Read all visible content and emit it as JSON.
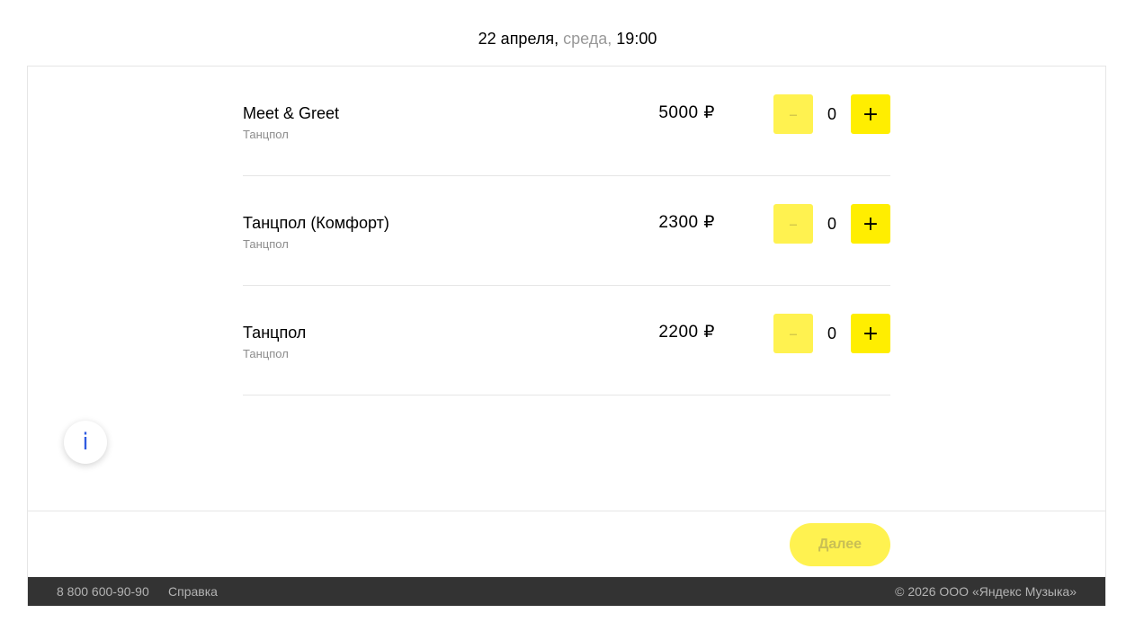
{
  "header": {
    "date": "22 апреля,",
    "weekday": "среда,",
    "time": "19:00"
  },
  "tickets": [
    {
      "name": "Meet & Greet",
      "sector": "Танцпол",
      "price": "5000 ₽",
      "quantity": "0",
      "minus_label": "–",
      "plus_label": "+"
    },
    {
      "name": "Танцпол (Комфорт)",
      "sector": "Танцпол",
      "price": "2300 ₽",
      "quantity": "0",
      "minus_label": "–",
      "plus_label": "+"
    },
    {
      "name": "Танцпол",
      "sector": "Танцпол",
      "price": "2200 ₽",
      "quantity": "0",
      "minus_label": "–",
      "plus_label": "+"
    }
  ],
  "info": {
    "icon": "info-icon",
    "glyph": "i"
  },
  "actions": {
    "next_label": "Далее"
  },
  "footer": {
    "phone": "8 800 600-90-90",
    "help": "Справка",
    "copyright": "© 2026 ООО «Яндекс Музыка»"
  },
  "colors": {
    "accent_yellow": "#ffee00",
    "disabled_yellow": "#fff250",
    "footer_bg": "#333333",
    "info_blue": "#2f5be0"
  }
}
